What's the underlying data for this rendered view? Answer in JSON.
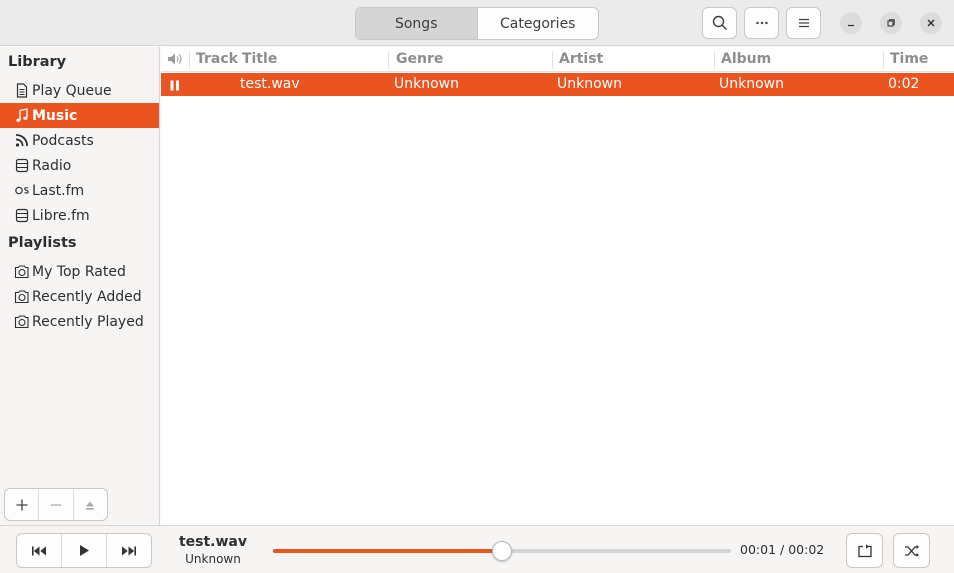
{
  "header": {
    "tabs": [
      {
        "label": "Songs",
        "active": true
      },
      {
        "label": "Categories",
        "active": false
      }
    ],
    "icons": [
      "search-icon",
      "more-icon",
      "menu-icon"
    ],
    "window_controls": [
      "minimize-icon",
      "restore-icon",
      "close-icon"
    ]
  },
  "sidebar": {
    "library_title": "Library",
    "library_items": [
      {
        "label": "Play Queue",
        "icon": "document-icon",
        "active": false
      },
      {
        "label": "Music",
        "icon": "music-note-icon",
        "active": true
      },
      {
        "label": "Podcasts",
        "icon": "rss-icon",
        "active": false
      },
      {
        "label": "Radio",
        "icon": "radio-icon",
        "active": false
      },
      {
        "label": "Last.fm",
        "icon": "lastfm-icon",
        "active": false
      },
      {
        "label": "Libre.fm",
        "icon": "radio-icon",
        "active": false
      }
    ],
    "playlists_title": "Playlists",
    "playlist_items": [
      {
        "label": "My Top Rated",
        "icon": "playlist-icon"
      },
      {
        "label": "Recently Added",
        "icon": "playlist-icon"
      },
      {
        "label": "Recently Played",
        "icon": "playlist-icon"
      }
    ],
    "tools": [
      "add-icon",
      "remove-icon",
      "eject-icon"
    ]
  },
  "table": {
    "columns": [
      "Track",
      "Title",
      "Genre",
      "Artist",
      "Album",
      "Time"
    ],
    "rows": [
      {
        "track": "",
        "title": "test.wav",
        "genre": "Unknown",
        "artist": "Unknown",
        "album": "Unknown",
        "time": "0:02",
        "playing": true
      }
    ]
  },
  "player": {
    "title": "test.wav",
    "artist": "Unknown",
    "elapsed": "00:01",
    "total": "00:02",
    "progress": 0.5,
    "accent": "#e95420"
  }
}
